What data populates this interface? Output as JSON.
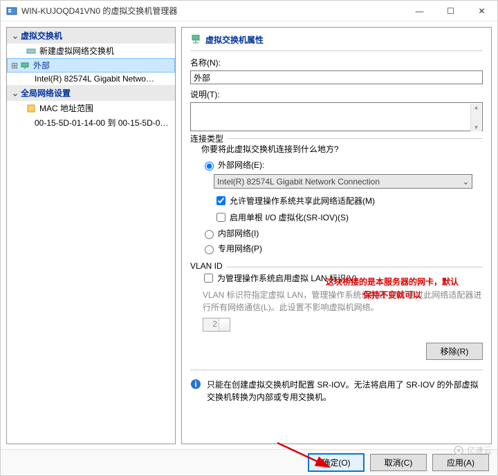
{
  "window": {
    "title": "WIN-KUJOQD41VN0 的虚拟交换机管理器",
    "min": "—",
    "max": "☐",
    "close": "✕"
  },
  "tree": {
    "section1": "虚拟交换机",
    "new_switch": "新建虚拟网络交换机",
    "external": "外部",
    "external_nic": "Intel(R) 82574L Gigabit Netwo…",
    "section2": "全局网络设置",
    "mac_range": "MAC 地址范围",
    "mac_range_detail": "00-15-5D-01-14-00 到 00-15-5D-0…"
  },
  "props": {
    "title": "虚拟交换机属性",
    "name_label": "名称(N):",
    "name_value": "外部",
    "desc_label": "说明(T):"
  },
  "conn": {
    "group": "连接类型",
    "prompt": "你要将此虚拟交换机连接到什么地方?",
    "external_label": "外部网络(E):",
    "nic": "Intel(R) 82574L Gigabit Network Connection",
    "allow_mgmt": "允许管理操作系统共享此网络适配器(M)",
    "sriov": "启用单根 I/O 虚拟化(SR-IOV)(S)",
    "internal_label": "内部网络(I)",
    "private_label": "专用网络(P)"
  },
  "annotation": {
    "line1": "这块桥接的是本服务器的网卡，默认",
    "line2": "保持不变就可以"
  },
  "vlan": {
    "group": "VLAN ID",
    "enable": "为管理操作系统启用虚拟 LAN 标识(V)",
    "note": "VLAN 标识符指定虚拟 LAN，管理操作系统使用该 LAN 通过此网络适配器进行所有网络通信(L)。此设置不影响虚拟机网络。",
    "value": "2"
  },
  "remove_btn": "移除(R)",
  "info_msg": "只能在创建虚拟交换机时配置 SR-IOV。无法将启用了 SR-IOV 的外部虚拟交换机转换为内部或专用交换机。",
  "buttons": {
    "ok": "确定(O)",
    "cancel": "取消(C)",
    "apply": "应用(A)"
  },
  "watermark": "亿速云"
}
